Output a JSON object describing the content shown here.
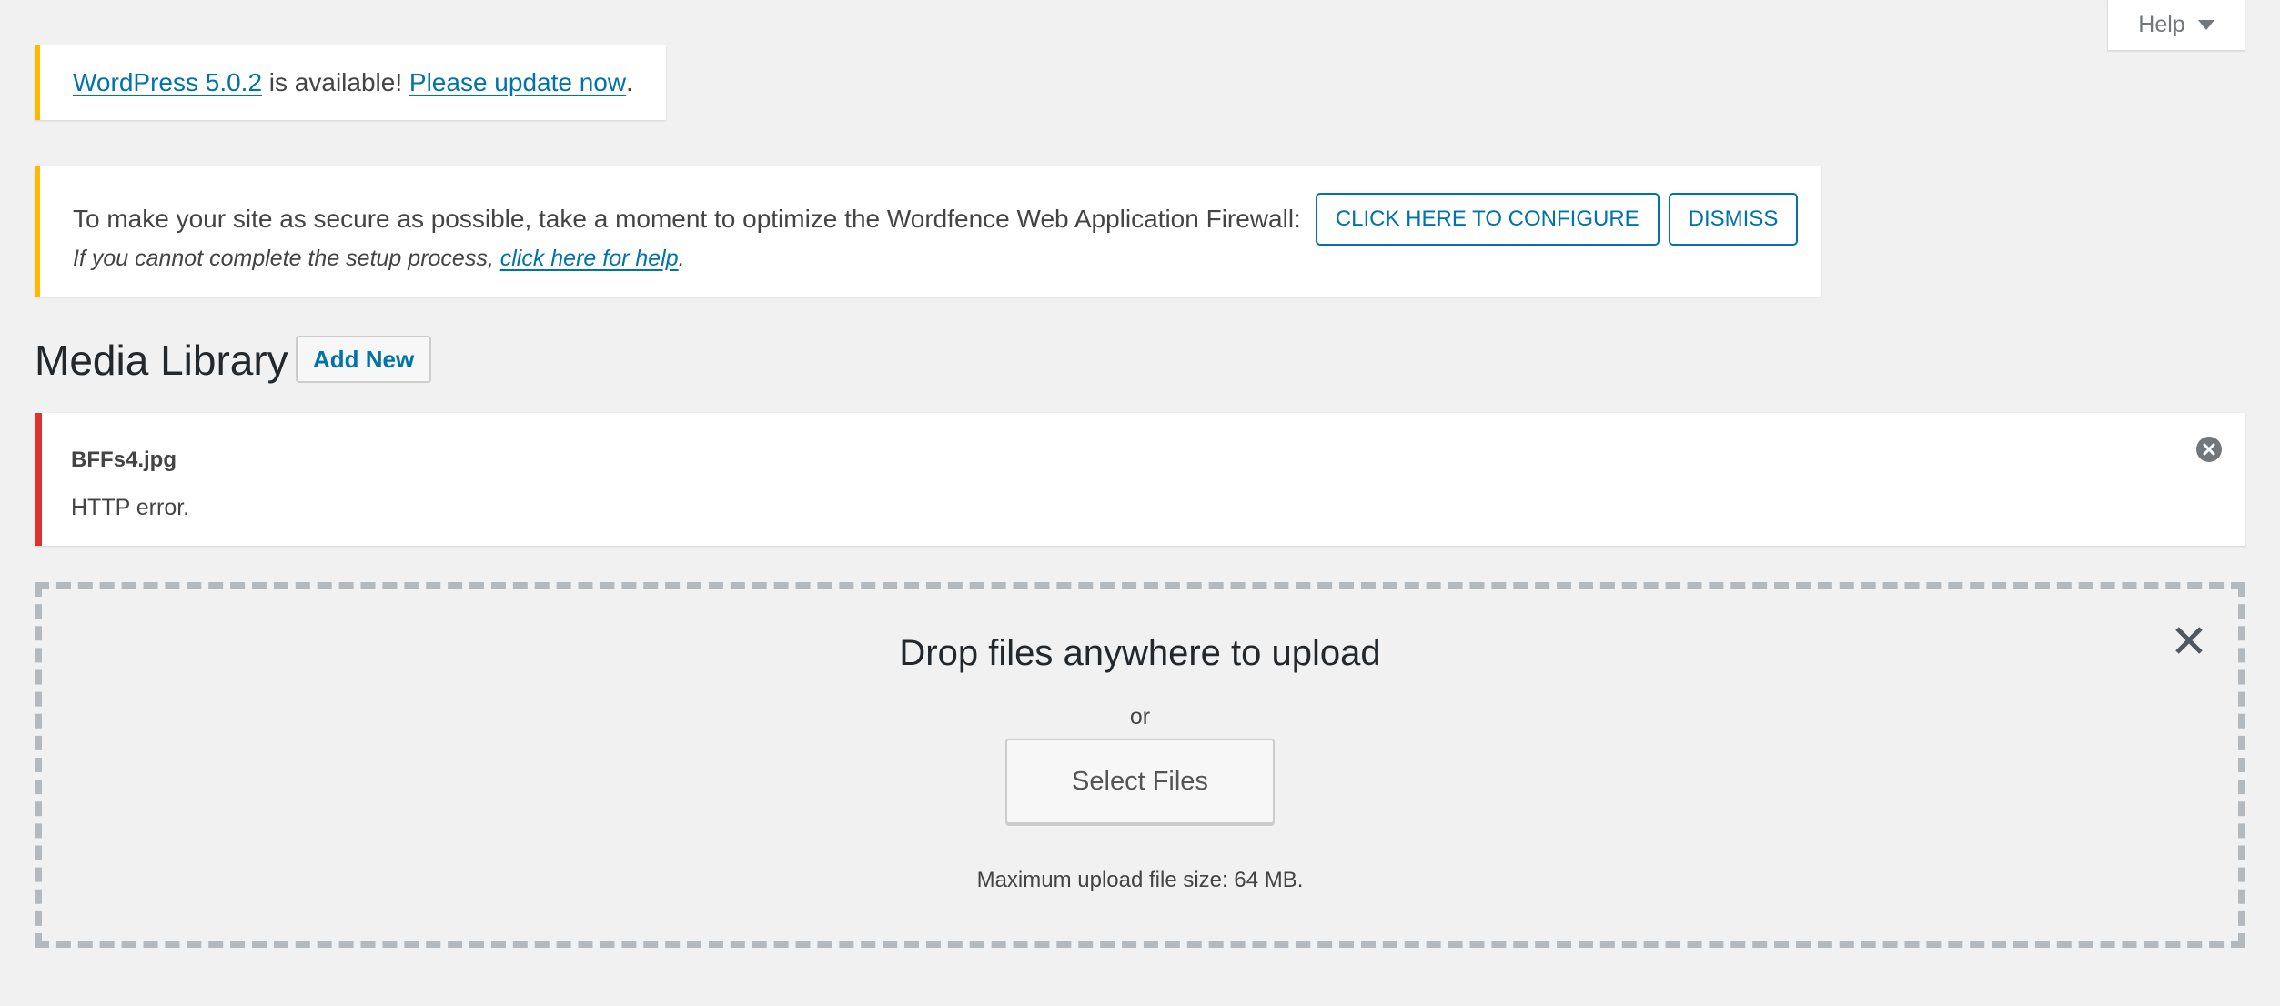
{
  "help_tab": {
    "label": "Help",
    "icon": "caret-down-icon"
  },
  "update_notice": {
    "version_link": "WordPress 5.0.2",
    "middle_text": " is available! ",
    "update_link": "Please update now",
    "end_text": ".",
    "accent_color": "#ffb900"
  },
  "wordfence_notice": {
    "message": "To make your site as secure as possible, take a moment to optimize the Wordfence Web Application Firewall:",
    "configure_button": "CLICK HERE TO CONFIGURE",
    "dismiss_button": "DISMISS",
    "help_prefix": "If you cannot complete the setup process, ",
    "help_link": "click here for help",
    "help_suffix": ".",
    "accent_color": "#ffb900"
  },
  "page": {
    "title": "Media Library",
    "add_new_label": "Add New"
  },
  "upload_error": {
    "filename": "BFFs4.jpg",
    "message": "HTTP error.",
    "dismiss_icon": "dismiss-circle-icon",
    "accent_color": "#dc3232"
  },
  "uploader": {
    "title": "Drop files anywhere to upload",
    "or_text": "or",
    "select_button": "Select Files",
    "max_size_text": "Maximum upload file size: 64 MB.",
    "close_icon": "close-icon"
  },
  "colors": {
    "link": "#0073aa",
    "background": "#f1f1f1",
    "dashed_border": "#b4b9be"
  }
}
